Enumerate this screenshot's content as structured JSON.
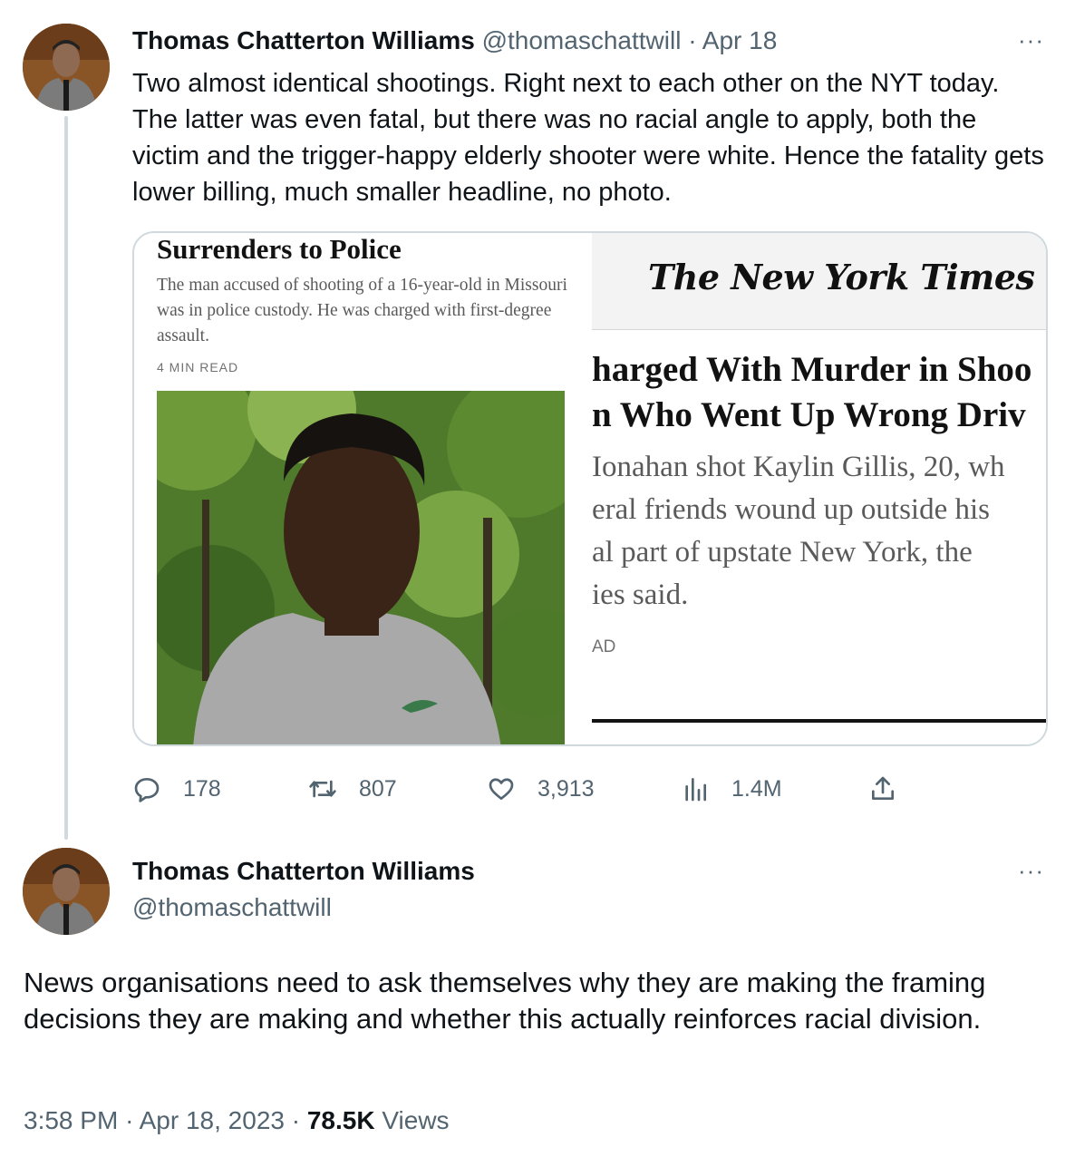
{
  "tweet1": {
    "author_name": "Thomas Chatterton Williams",
    "handle": "@thomaschattwill",
    "separator": "·",
    "date": "Apr 18",
    "more_label": "···",
    "text": "Two almost identical shootings. Right next to each other on the NYT today. The latter was even fatal, but there was no racial angle to apply, both the victim and the trigger-happy elderly shooter were white. Hence the fatality gets lower billing, much smaller headline, no photo.",
    "media": {
      "left": {
        "headline": "Surrenders to Police",
        "summary": "The man accused of shooting of a 16-year-old in Missouri was in police custody. He was charged with first-degree assault.",
        "read_time": "4 MIN READ"
      },
      "right": {
        "logo": "The New York Times",
        "headline_lines": [
          "harged With Murder in Shoo",
          "n Who Went Up Wrong Driv"
        ],
        "summary_lines": [
          "Ionahan shot Kaylin Gillis, 20, wh",
          "eral friends wound up outside his",
          "al part of upstate New York, the",
          "ies said."
        ],
        "read_time": "AD"
      }
    },
    "actions": {
      "replies": "178",
      "retweets": "807",
      "likes": "3,913",
      "views": "1.4M"
    },
    "icons": [
      "reply-icon",
      "retweet-icon",
      "like-icon",
      "views-icon",
      "share-icon"
    ]
  },
  "tweet2": {
    "author_name": "Thomas Chatterton Williams",
    "handle": "@thomaschattwill",
    "more_label": "···",
    "text": "News organisations need to ask themselves why they are making the framing decisions they are making and whether this actually reinforces racial division.",
    "time": "3:58 PM",
    "separator": "·",
    "date": "Apr 18, 2023",
    "views_count": "78.5K",
    "views_label": "Views"
  },
  "colors": {
    "text": "#0f1419",
    "muted": "#536471",
    "border": "#cfd9de"
  }
}
